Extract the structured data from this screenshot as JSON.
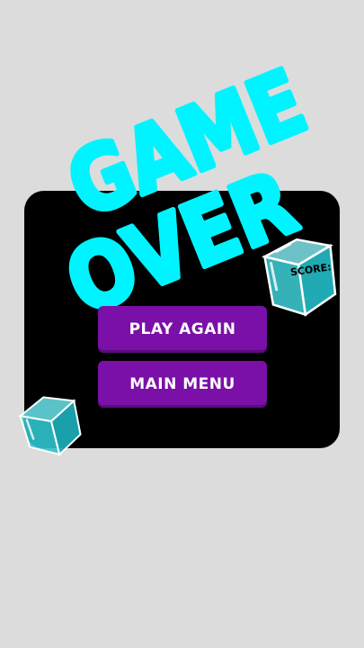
{
  "title": {
    "line1": "GAME",
    "line2": "OVER"
  },
  "buttons": {
    "play_again": "PLAY AGAIN",
    "main_menu": "MAIN MENU"
  },
  "cube": {
    "score_label": "SCORE:"
  },
  "colors": {
    "background": "#dcdcdc",
    "panel": "#000000",
    "title": "#00f4ff",
    "button": "#7a10a8",
    "button_text": "#ffffff",
    "cube": "#26c6cf"
  }
}
